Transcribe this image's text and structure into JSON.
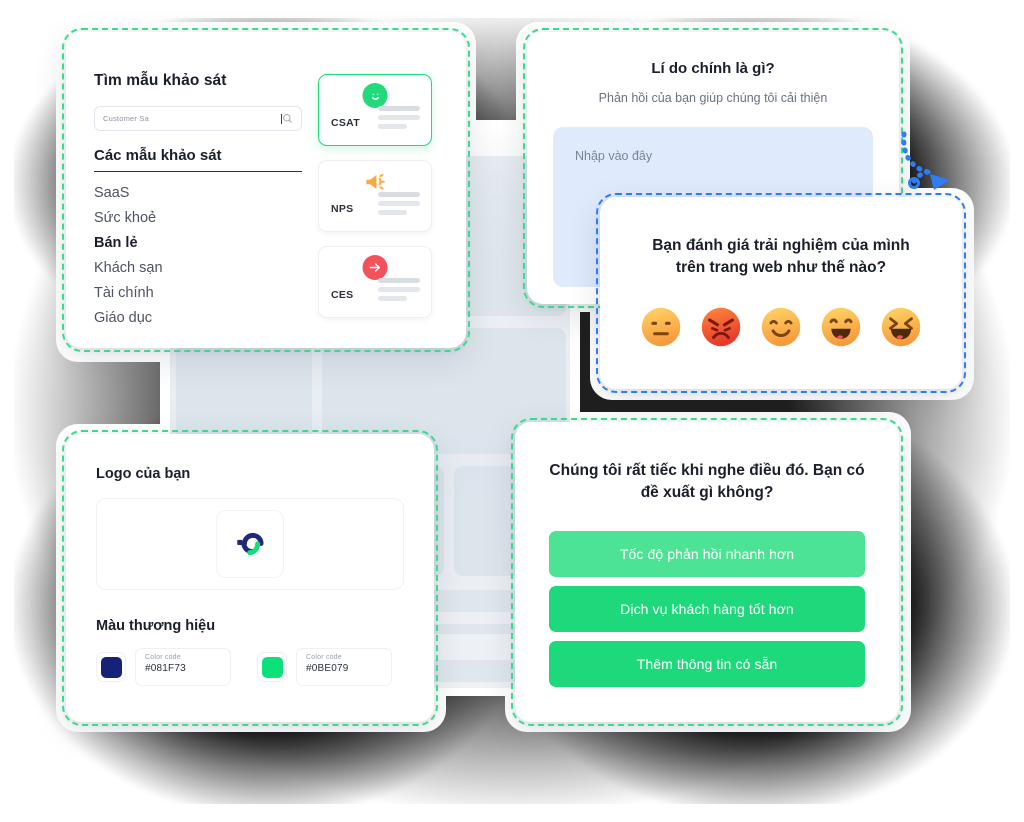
{
  "theme": {
    "green": "#1ED97C",
    "green_hover": "#4CE394",
    "select_green": "#36DD8A",
    "select_blue": "#2F7DF6",
    "navy": "#081F73",
    "orange": "#FFA83A",
    "red": "#F4525B"
  },
  "templates_card": {
    "title": "Tìm mẫu khảo sát",
    "search": {
      "value": "Customer Sa",
      "icon": "search-icon"
    },
    "list_title": "Các mẫu khảo sát",
    "items": [
      {
        "label": "SaaS",
        "active": false
      },
      {
        "label": "Sức khoẻ",
        "active": false
      },
      {
        "label": "Bán lẻ",
        "active": true
      },
      {
        "label": "Khách sạn",
        "active": false
      },
      {
        "label": "Tài chính",
        "active": false
      },
      {
        "label": "Giáo dục",
        "active": false
      }
    ],
    "types": [
      {
        "code": "CSAT",
        "icon": "smiley-face-icon",
        "selected": true
      },
      {
        "code": "NPS",
        "icon": "megaphone-icon",
        "selected": false
      },
      {
        "code": "CES",
        "icon": "arrow-right-circle-icon",
        "selected": false
      }
    ]
  },
  "reason_card": {
    "title": "Lí do chính là gì?",
    "subtitle": "Phản hồi của bạn giúp chúng tôi cải thiện",
    "textarea_placeholder": "Nhập vào đây",
    "textarea_value": ""
  },
  "rating_card": {
    "title": "Bạn đánh giá trải nghiệm của mình trên trang web như thế nào?",
    "emojis": [
      {
        "name": "neutral-face-emoji",
        "value": 1
      },
      {
        "name": "angry-face-emoji",
        "value": 2
      },
      {
        "name": "slight-smile-emoji",
        "value": 3
      },
      {
        "name": "happy-face-emoji",
        "value": 4
      },
      {
        "name": "laughing-face-emoji",
        "value": 5
      }
    ]
  },
  "brand_card": {
    "logo_title": "Logo của bạn",
    "logo_icon": "company-logo",
    "colors_title": "Màu thương hiệu",
    "swatches": [
      {
        "label": "Color code",
        "value": "#081F73",
        "hex": "#152277"
      },
      {
        "label": "Color code",
        "value": "#0BE079",
        "hex": "#0BE079"
      }
    ]
  },
  "suggestions_card": {
    "title": "Chúng tôi rất tiếc khi nghe điều đó. Bạn có đề xuất gì không?",
    "buttons": [
      {
        "label": "Tốc độ phản hồi nhanh hơn",
        "hover": true
      },
      {
        "label": "Dịch vụ khách hàng tốt hơn",
        "hover": false
      },
      {
        "label": "Thêm thông tin có sẵn",
        "hover": false
      }
    ]
  },
  "pointer": {
    "name": "dotted-curved-arrow-cursor"
  }
}
